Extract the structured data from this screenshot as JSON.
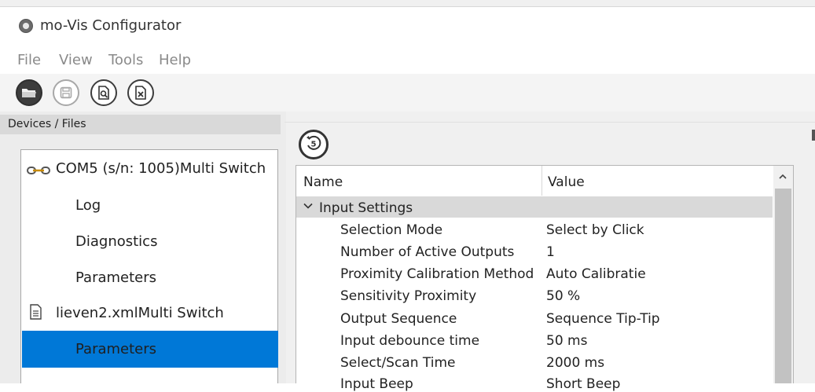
{
  "window": {
    "title": "mo-Vis Configurator"
  },
  "menu": [
    "File",
    "View",
    "Tools",
    "Help"
  ],
  "toolbar": {
    "buttons": [
      {
        "icon": "open-folder-icon"
      },
      {
        "icon": "save-icon"
      },
      {
        "icon": "search-document-icon"
      },
      {
        "icon": "close-document-icon"
      }
    ]
  },
  "devices": {
    "header": "Devices / Files",
    "tree": [
      {
        "label": "COM5 (s/n: 1005)Multi Switch",
        "icon": "connection-icon"
      },
      {
        "label": "Log"
      },
      {
        "label": "Diagnostics"
      },
      {
        "label": "Parameters"
      },
      {
        "label": "lieven2.xmlMulti Switch",
        "icon": "document-icon"
      },
      {
        "label": "Parameters",
        "selected": true
      }
    ]
  },
  "grid": {
    "columns": [
      "Name",
      "Value"
    ],
    "category": "Input Settings",
    "rows": [
      {
        "name": "Selection Mode",
        "value": "Select by Click"
      },
      {
        "name": "Number of Active Outputs",
        "value": "1"
      },
      {
        "name": "Proximity Calibration Method",
        "value": "Auto Calibratie"
      },
      {
        "name": "Sensitivity Proximity",
        "value": "50 %"
      },
      {
        "name": "Output Sequence",
        "value": "Sequence Tip-Tip"
      },
      {
        "name": "Input debounce time",
        "value": "50 ms"
      },
      {
        "name": "Select/Scan Time",
        "value": "2000 ms"
      },
      {
        "name": "Input Beep",
        "value": "Short Beep"
      }
    ]
  },
  "colors": {
    "selection": "#0078d7",
    "category_row": "#d9d9d9",
    "panel_bg": "#f0f0f0"
  }
}
